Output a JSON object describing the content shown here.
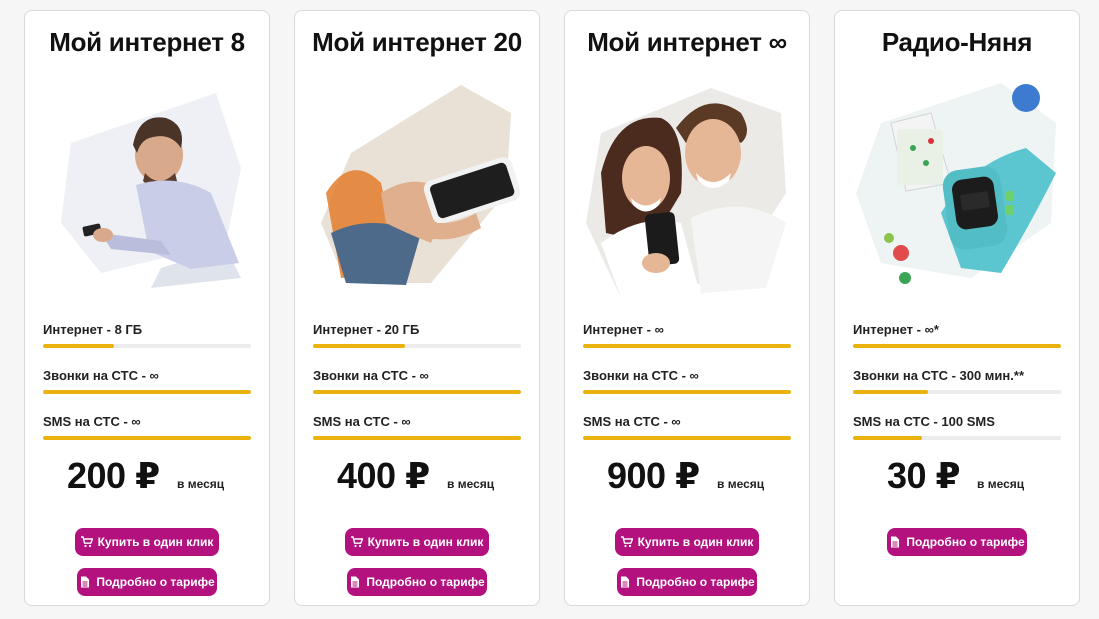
{
  "plans": [
    {
      "title": "Мой интернет 8",
      "features": [
        {
          "label": "Интернет - 8 ГБ",
          "level": 0.34
        },
        {
          "label": "Звонки на СТС - ∞",
          "level": 1
        },
        {
          "label": "SMS на СТС - ∞",
          "level": 1
        }
      ],
      "price": "200 ₽",
      "price_period": "в месяц",
      "buy_label": "Купить в один клик",
      "details_label": "Подробно о тарифе"
    },
    {
      "title": "Мой интернет 20",
      "features": [
        {
          "label": "Интернет - 20 ГБ",
          "level": 0.44
        },
        {
          "label": "Звонки на СТС - ∞",
          "level": 1
        },
        {
          "label": "SMS на СТС - ∞",
          "level": 1
        }
      ],
      "price": "400 ₽",
      "price_period": "в месяц",
      "buy_label": "Купить в один клик",
      "details_label": "Подробно о тарифе"
    },
    {
      "title": "Мой интернет ∞",
      "features": [
        {
          "label": "Интернет - ∞",
          "level": 1
        },
        {
          "label": "Звонки на СТС - ∞",
          "level": 1
        },
        {
          "label": "SMS на СТС - ∞",
          "level": 1
        }
      ],
      "price": "900 ₽",
      "price_period": "в месяц",
      "buy_label": "Купить в один клик",
      "details_label": "Подробно о тарифе"
    },
    {
      "title": "Радио-Няня",
      "features": [
        {
          "label": "Интернет - ∞*",
          "level": 1
        },
        {
          "label": "Звонки на СТС - 300 мин.**",
          "level": 0.36
        },
        {
          "label": "SMS на СТС - 100 SMS",
          "level": 0.33
        }
      ],
      "price": "30 ₽",
      "price_period": "в месяц",
      "details_label": "Подробно о тарифе"
    }
  ],
  "colors": {
    "accent_button": "#b3127e",
    "progress_fill": "#e9b20c",
    "progress_track": "#ececec"
  },
  "icons": {
    "buy": "cart-icon",
    "details": "document-icon"
  }
}
